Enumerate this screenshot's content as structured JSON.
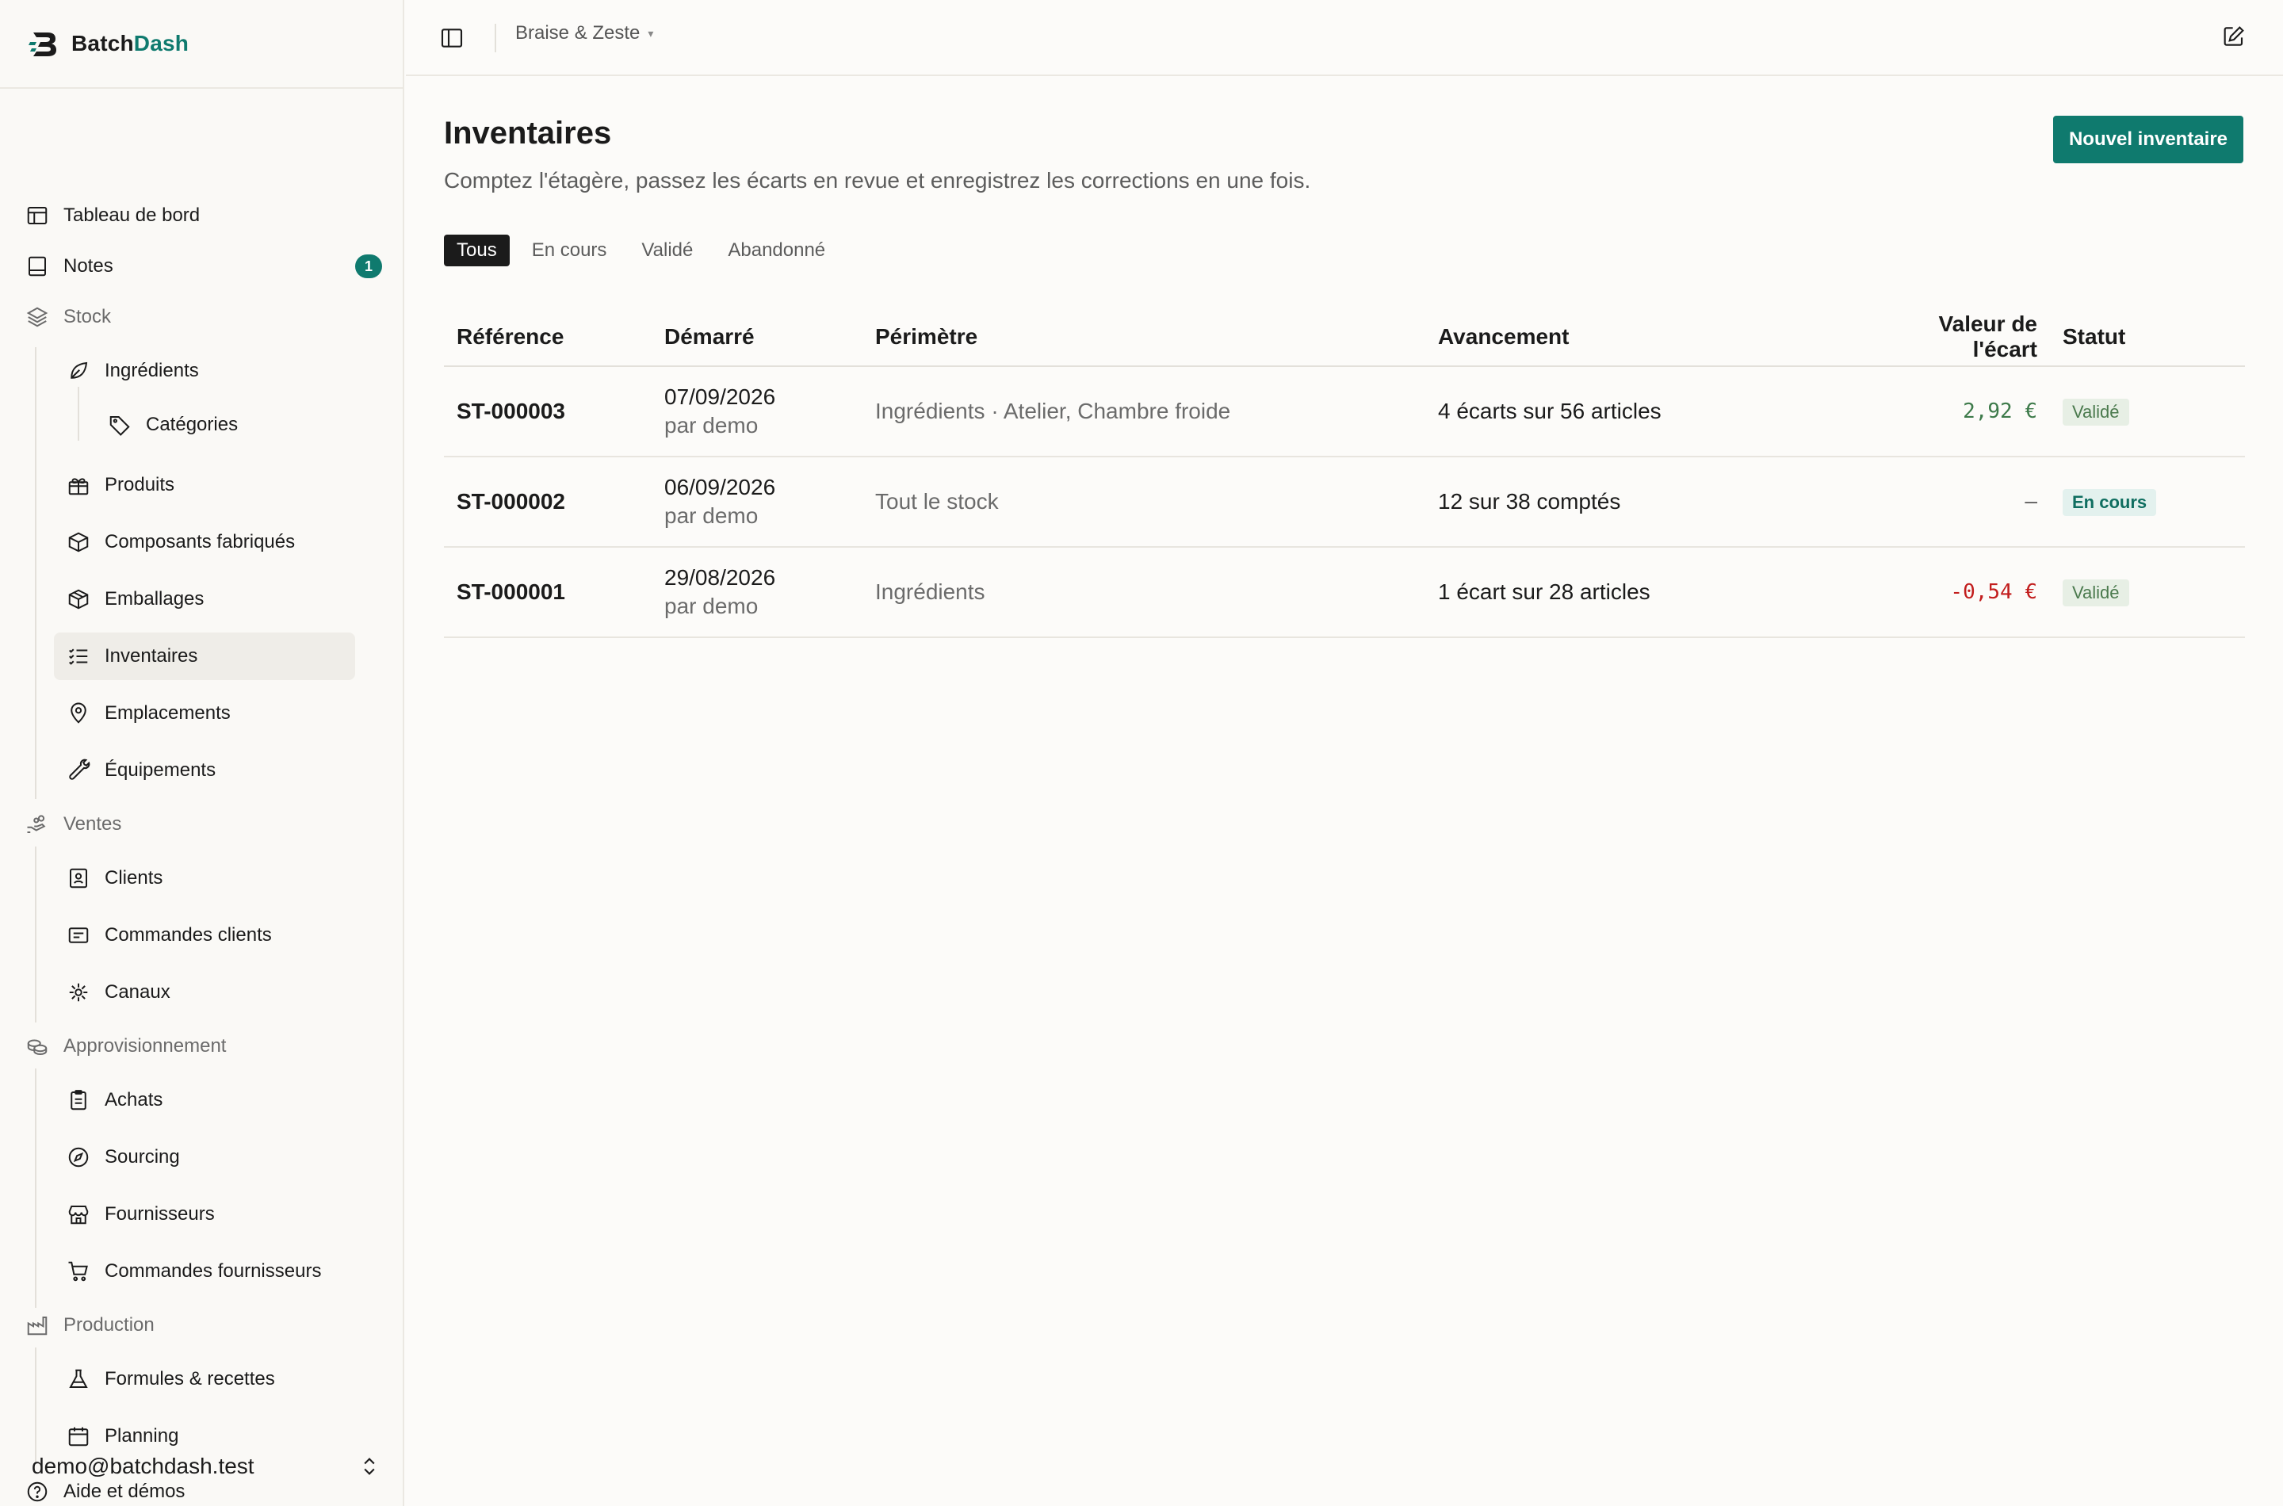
{
  "brand": {
    "name_part1": "Batch",
    "name_part2": "Dash"
  },
  "sidebar": {
    "dashboard": "Tableau de bord",
    "notes": "Notes",
    "notes_badge": "1",
    "stock": "Stock",
    "ingredients": "Ingrédients",
    "categories": "Catégories",
    "products": "Produits",
    "manufactured": "Composants fabriqués",
    "packaging": "Emballages",
    "inventories": "Inventaires",
    "locations": "Emplacements",
    "equipment": "Équipements",
    "sales": "Ventes",
    "clients": "Clients",
    "client_orders": "Commandes clients",
    "channels": "Canaux",
    "procurement": "Approvisionnement",
    "purchases": "Achats",
    "sourcing": "Sourcing",
    "suppliers": "Fournisseurs",
    "supplier_orders": "Commandes fournisseurs",
    "production": "Production",
    "recipes": "Formules & recettes",
    "planning": "Planning",
    "help": "Aide et démos",
    "user_email": "demo@batchdash.test"
  },
  "topbar": {
    "workspace": "Braise & Zeste"
  },
  "page": {
    "title": "Inventaires",
    "subtitle": "Comptez l'étagère, passez les écarts en revue et enregistrez les corrections en une fois.",
    "new_button": "Nouvel inventaire"
  },
  "tabs": [
    "Tous",
    "En cours",
    "Validé",
    "Abandonné"
  ],
  "table": {
    "headers": {
      "reference": "Référence",
      "started": "Démarré",
      "scope": "Périmètre",
      "progress": "Avancement",
      "variance": "Valeur de l'écart",
      "status": "Statut"
    },
    "rows": [
      {
        "reference": "ST-000003",
        "date": "07/09/2026",
        "by": "par demo",
        "scope": "Ingrédients · Atelier, Chambre froide",
        "progress": "4 écarts sur 56 articles",
        "variance": "2,92 €",
        "status": "Validé"
      },
      {
        "reference": "ST-000002",
        "date": "06/09/2026",
        "by": "par demo",
        "scope": "Tout le stock",
        "progress": "12 sur 38 comptés",
        "variance": "–",
        "status": "En cours"
      },
      {
        "reference": "ST-000001",
        "date": "29/08/2026",
        "by": "par demo",
        "scope": "Ingrédients",
        "progress": "1 écart sur 28 articles",
        "variance": "-0,54 €",
        "status": "Validé"
      }
    ]
  },
  "colors": {
    "accent": "#0f7a6e",
    "positive": "#3d7a4a",
    "negative": "#c21d1d"
  }
}
